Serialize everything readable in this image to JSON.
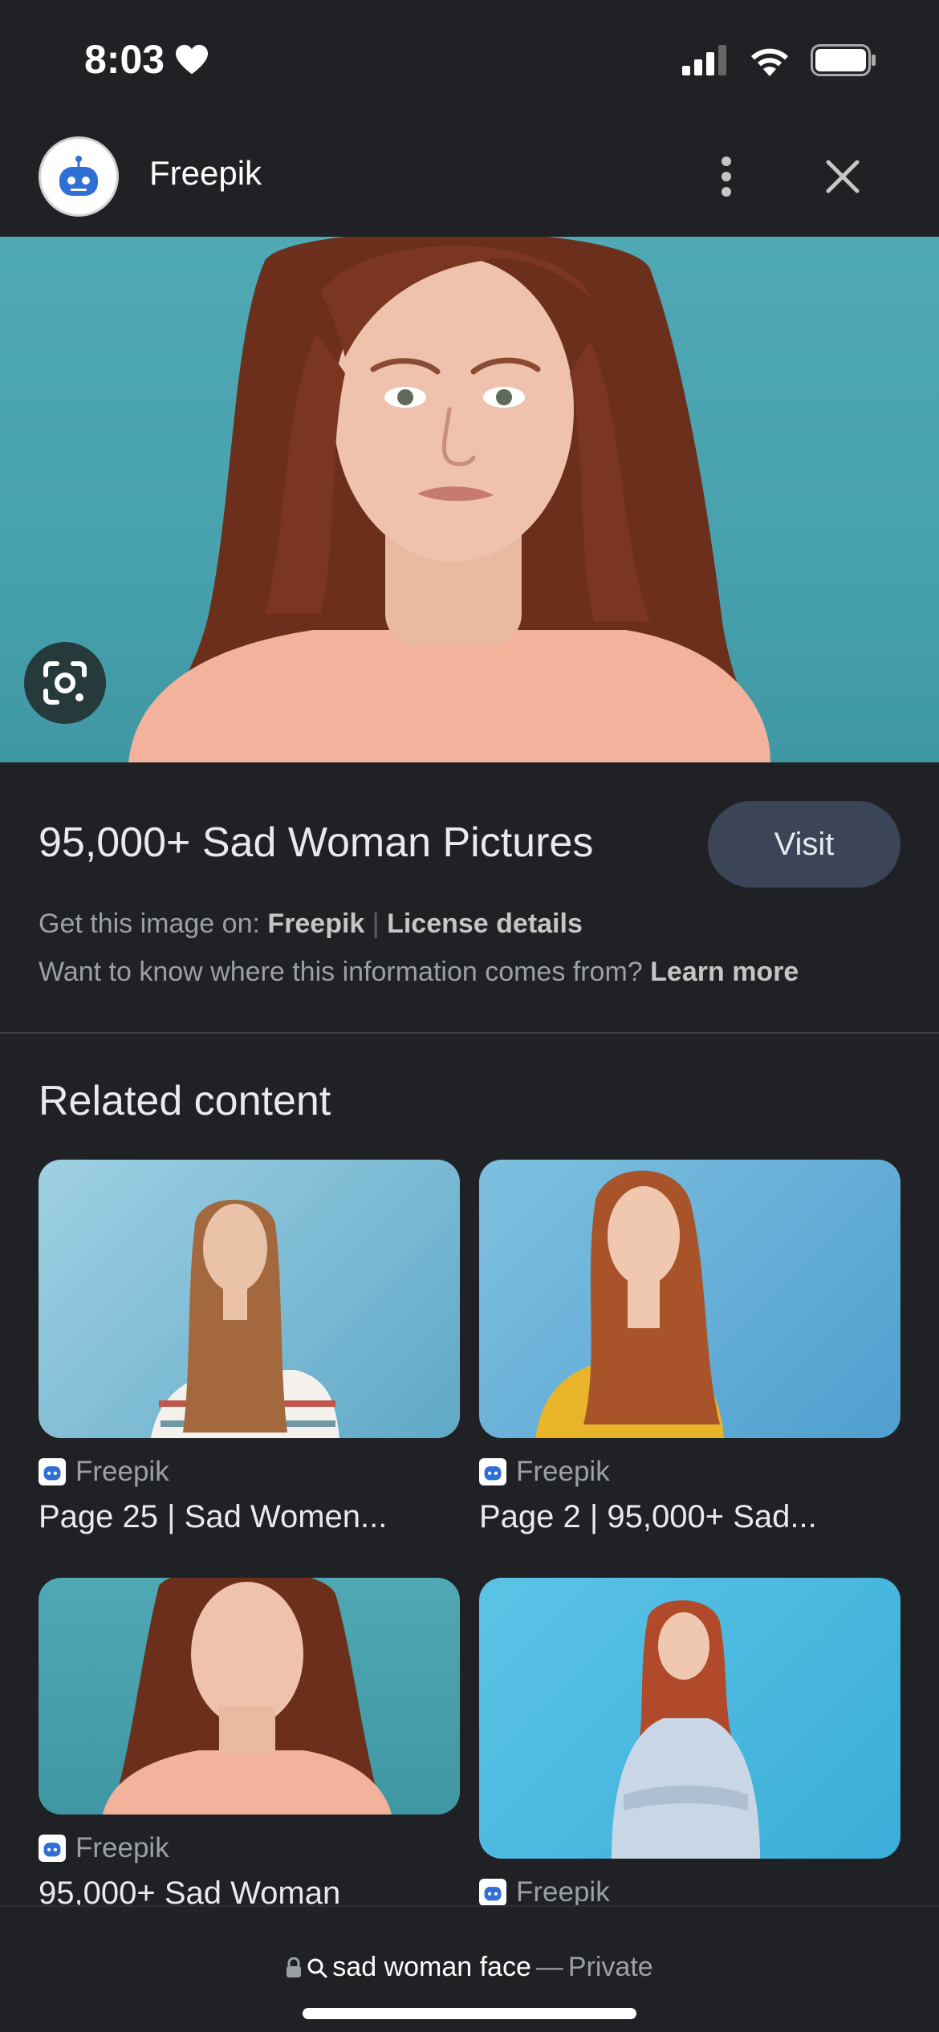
{
  "status_bar": {
    "time": "8:03",
    "icons": [
      "heart-icon",
      "cellular-signal-icon",
      "wifi-icon",
      "battery-icon"
    ]
  },
  "header": {
    "site_name": "Freepik",
    "avatar_icon": "freepik-robot-icon",
    "more_icon": "more-vertical-icon",
    "close_icon": "close-icon"
  },
  "hero": {
    "lens_icon": "google-lens-icon",
    "image_description_icon": "photo"
  },
  "result": {
    "title": "95,000+ Sad Woman Pictures",
    "visit_label": "Visit",
    "source_prefix": "Get this image on:",
    "source_name": "Freepik",
    "separator": "|",
    "license_label": "License details",
    "info_question": "Want to know where this information comes from?",
    "learn_more": "Learn more"
  },
  "related": {
    "heading": "Related content",
    "items": [
      {
        "source": "Freepik",
        "title": "Page 25 | Sad Women..."
      },
      {
        "source": "Freepik",
        "title": "Page 2 | 95,000+ Sad..."
      },
      {
        "source": "Freepik",
        "title": "95,000+ Sad Woman"
      },
      {
        "source": "Freepik",
        "title": ""
      }
    ]
  },
  "bottom_bar": {
    "query": "sad woman face",
    "dash": "—",
    "mode": "Private"
  },
  "colors": {
    "background": "#202124",
    "visit_button": "#3c4458",
    "hero_bg": "#4fa8b3"
  }
}
